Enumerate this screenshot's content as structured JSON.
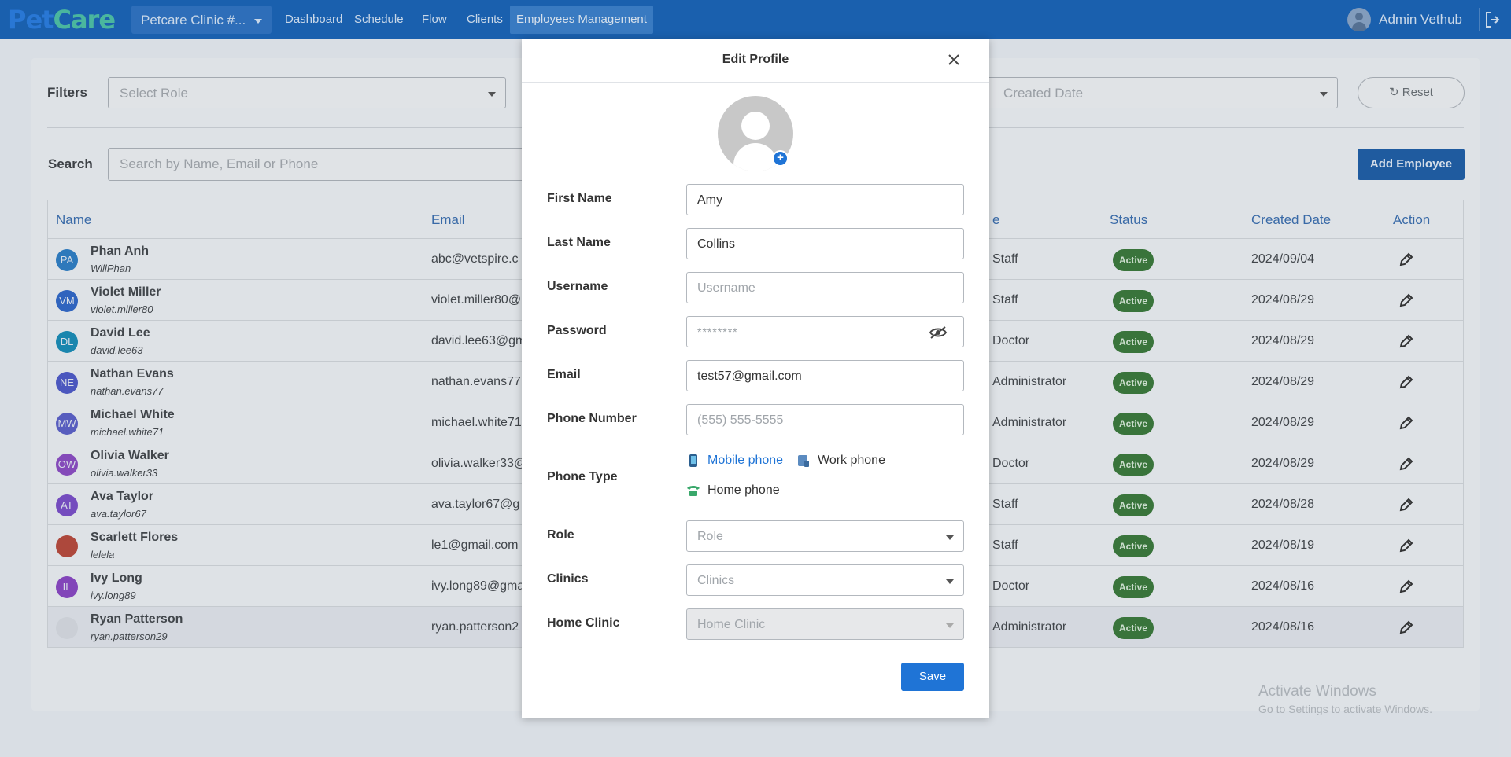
{
  "topbar": {
    "logo_a": "Pet",
    "logo_b": "Care",
    "clinic": "Petcare Clinic #...",
    "nav": [
      "Dashboard",
      "Schedule",
      "Flow",
      "Clients",
      "Employees Management"
    ],
    "active_nav": "Employees Management",
    "user": "Admin Vethub"
  },
  "filters": {
    "label": "Filters",
    "role_placeholder": "Select Role",
    "date_placeholder": "Created Date",
    "reset": "Reset"
  },
  "search": {
    "label": "Search",
    "placeholder": "Search by Name, Email or Phone",
    "add_button": "Add Employee"
  },
  "table": {
    "headers": {
      "name": "Name",
      "email": "Email",
      "role": "e",
      "status": "Status",
      "created": "Created Date",
      "action": "Action"
    },
    "rows": [
      {
        "initials": "PA",
        "color": "#2f7fc6",
        "name": "Phan Anh",
        "username": "WillPhan",
        "email": "abc@vetspire.c",
        "role": "Staff",
        "status": "Active",
        "date": "2024/09/04"
      },
      {
        "initials": "VM",
        "color": "#3169c9",
        "name": "Violet Miller",
        "username": "violet.miller80",
        "email": "violet.miller80@",
        "role": "Staff",
        "status": "Active",
        "date": "2024/08/29"
      },
      {
        "initials": "DL",
        "color": "#1a8eb8",
        "name": "David Lee",
        "username": "david.lee63",
        "email": "david.lee63@gm",
        "role": "Doctor",
        "status": "Active",
        "date": "2024/08/29"
      },
      {
        "initials": "NE",
        "color": "#4f5bc9",
        "name": "Nathan Evans",
        "username": "nathan.evans77",
        "email": "nathan.evans77",
        "role": "Administrator",
        "status": "Active",
        "date": "2024/08/29"
      },
      {
        "initials": "MW",
        "color": "#5c61c9",
        "name": "Michael White",
        "username": "michael.white71",
        "email": "michael.white71",
        "role": "Administrator",
        "status": "Active",
        "date": "2024/08/29"
      },
      {
        "initials": "OW",
        "color": "#8c4cc4",
        "name": "Olivia Walker",
        "username": "olivia.walker33",
        "email": "olivia.walker33@",
        "role": "Doctor",
        "status": "Active",
        "date": "2024/08/29"
      },
      {
        "initials": "AT",
        "color": "#7b4fc9",
        "name": "Ava Taylor",
        "username": "ava.taylor67",
        "email": "ava.taylor67@g",
        "role": "Staff",
        "status": "Active",
        "date": "2024/08/28"
      },
      {
        "initials": "",
        "color": "#b94a3c",
        "name": "Scarlett Flores",
        "username": "lelela",
        "email": "le1@gmail.com",
        "role": "Staff",
        "status": "Active",
        "date": "2024/08/19"
      },
      {
        "initials": "IL",
        "color": "#8a47c4",
        "name": "Ivy Long",
        "username": "ivy.long89",
        "email": "ivy.long89@gma",
        "role": "Doctor",
        "status": "Active",
        "date": "2024/08/16"
      },
      {
        "initials": "",
        "color": "#d9dde3",
        "name": "Ryan Patterson",
        "username": "ryan.patterson29",
        "email": "ryan.patterson2",
        "role": "Administrator",
        "status": "Active",
        "date": "2024/08/16"
      }
    ]
  },
  "watermark": {
    "line1": "Activate Windows",
    "line2": "Go to Settings to activate Windows."
  },
  "modal": {
    "title": "Edit Profile",
    "fields": {
      "first_name": {
        "label": "First Name",
        "value": "Amy"
      },
      "last_name": {
        "label": "Last Name",
        "value": "Collins"
      },
      "username": {
        "label": "Username",
        "placeholder": "Username"
      },
      "password": {
        "label": "Password",
        "placeholder": "********"
      },
      "email": {
        "label": "Email",
        "value": "test57@gmail.com"
      },
      "phone": {
        "label": "Phone Number",
        "placeholder": "(555) 555-5555"
      },
      "phone_type": {
        "label": "Phone Type",
        "options": [
          "Mobile phone",
          "Work phone",
          "Home phone"
        ],
        "selected": "Mobile phone"
      },
      "role": {
        "label": "Role",
        "placeholder": "Role"
      },
      "clinics": {
        "label": "Clinics",
        "placeholder": "Clinics"
      },
      "home_clinic": {
        "label": "Home Clinic",
        "placeholder": "Home Clinic"
      }
    },
    "save": "Save"
  }
}
